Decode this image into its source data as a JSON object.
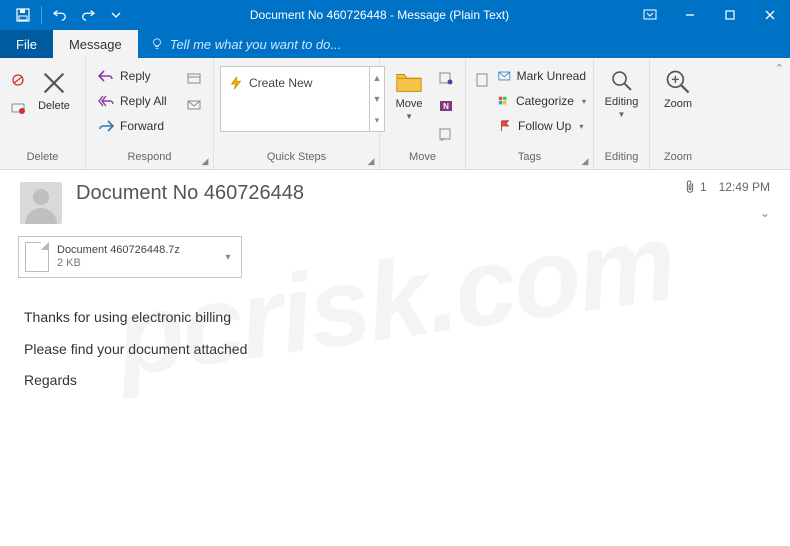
{
  "window": {
    "title": "Document No 460726448 - Message (Plain Text)"
  },
  "tabs": {
    "file": "File",
    "message": "Message",
    "tellme": "Tell me what you want to do..."
  },
  "ribbon": {
    "delete": {
      "label": "Delete",
      "big": "Delete"
    },
    "respond": {
      "label": "Respond",
      "reply": "Reply",
      "replyAll": "Reply All",
      "forward": "Forward"
    },
    "quicksteps": {
      "label": "Quick Steps",
      "createNew": "Create New"
    },
    "move": {
      "label": "Move",
      "big": "Move"
    },
    "tags": {
      "label": "Tags",
      "markUnread": "Mark Unread",
      "categorize": "Categorize",
      "followUp": "Follow Up"
    },
    "editing": {
      "label": "Editing",
      "big": "Editing"
    },
    "zoom": {
      "label": "Zoom",
      "big": "Zoom"
    }
  },
  "message": {
    "subject": "Document No 460726448",
    "attachmentCount": "1",
    "time": "12:49 PM",
    "attachment": {
      "name": "Document 460726448.7z",
      "size": "2 KB"
    },
    "body": {
      "p1": "Thanks for using electronic billing",
      "p2": "Please find your document attached",
      "p3": "Regards"
    }
  },
  "watermark": "pcrisk.com"
}
